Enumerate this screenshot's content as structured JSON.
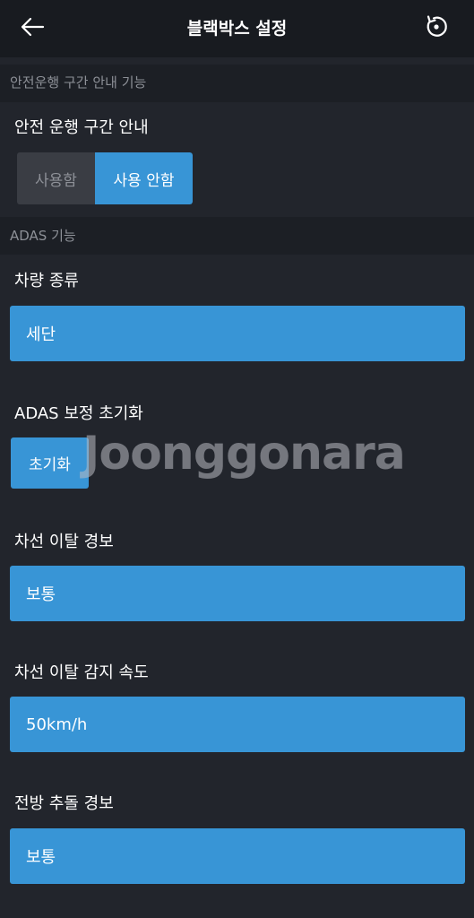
{
  "header": {
    "title": "블랙박스 설정",
    "back_icon": "arrow-left-icon",
    "reset_icon": "reset-icon"
  },
  "safe_driving": {
    "section_title": "안전운행 구간 안내 기능",
    "label": "안전 운행 구간 안내",
    "options": [
      "사용함",
      "사용 안함"
    ],
    "selected": "사용 안함"
  },
  "adas": {
    "section_title": "ADAS 기능",
    "vehicle_type": {
      "label": "차량 종류",
      "value": "세단"
    },
    "calibration_reset": {
      "label": "ADAS 보정 초기화",
      "button": "초기화"
    },
    "lane_departure": {
      "label": "차선 이탈 경보",
      "value": "보통"
    },
    "lane_speed": {
      "label": "차선 이탈 감지 속도",
      "value": "50km/h"
    },
    "forward_collision": {
      "label": "전방 추돌 경보",
      "value": "보통"
    }
  },
  "watermark": "Joonggonara",
  "colors": {
    "accent": "#3895d6",
    "background": "#22252c",
    "header": "#181b20",
    "section": "#1c1f25",
    "muted_text": "#8d9097",
    "inactive_button": "#3a3d44"
  }
}
